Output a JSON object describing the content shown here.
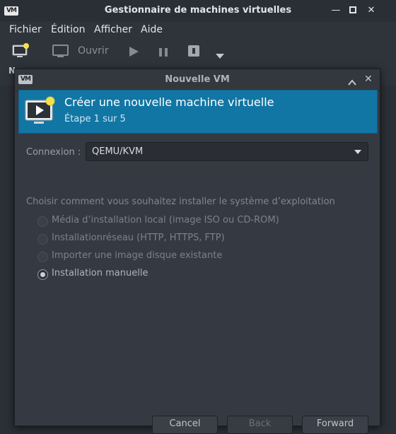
{
  "window": {
    "title": "Gestionnaire de machines virtuelles",
    "logo_text": "VM"
  },
  "menu": [
    "Fichier",
    "Édition",
    "Afficher",
    "Aide"
  ],
  "toolbar": {
    "open_label": "Ouvrir"
  },
  "list_header": {
    "name_col": "N"
  },
  "dialog": {
    "title": "Nouvelle VM",
    "logo_text": "VM",
    "banner_title": "Créer une nouvelle machine virtuelle",
    "banner_step": "Étape 1 sur 5",
    "connection_label": "Connexion :",
    "connection_value": "QEMU/KVM",
    "install_prompt": "Choisir comment vous souhaitez installer le système d’exploitation",
    "options": [
      {
        "label": "Média d’installation local (image ISO ou CD-ROM)",
        "selected": false,
        "enabled": false
      },
      {
        "label": "Installationréseau (HTTP, HTTPS, FTP)",
        "selected": false,
        "enabled": false
      },
      {
        "label": "Importer une image disque existante",
        "selected": false,
        "enabled": false
      },
      {
        "label": "Installation manuelle",
        "selected": true,
        "enabled": true
      }
    ],
    "buttons": {
      "cancel": "Cancel",
      "back": "Back",
      "forward": "Forward"
    }
  },
  "colors": {
    "banner": "#1276a4",
    "window_bg": "#2b2f36",
    "dialog_bg": "#353a42"
  }
}
